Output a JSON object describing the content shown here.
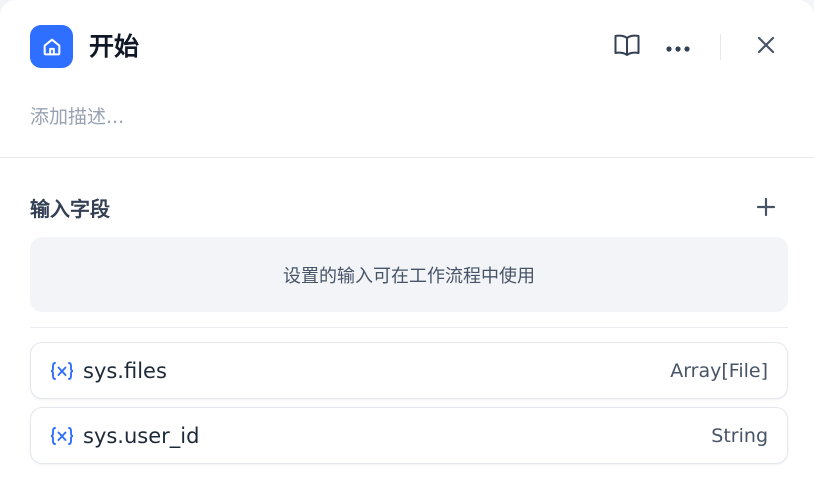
{
  "header": {
    "title": "开始",
    "icons": {
      "node": "home-icon",
      "docs": "book-open-icon",
      "more": "more-horizontal-icon",
      "close": "close-icon"
    }
  },
  "description": {
    "placeholder": "添加描述..."
  },
  "input_fields": {
    "title": "输入字段",
    "add_icon": "plus-icon",
    "empty_text": "设置的输入可在工作流程中使用"
  },
  "system_variables": [
    {
      "icon": "variable-icon",
      "name": "sys.files",
      "type": "Array[File]"
    },
    {
      "icon": "variable-icon",
      "name": "sys.user_id",
      "type": "String"
    }
  ],
  "colors": {
    "accent": "#2e6fff",
    "text": "#101828",
    "muted": "#98a2b3"
  }
}
